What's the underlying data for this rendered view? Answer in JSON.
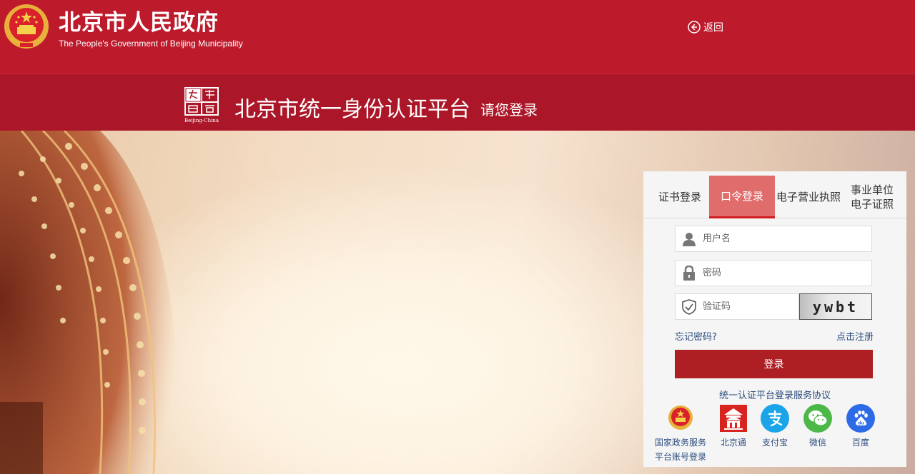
{
  "header": {
    "title": "北京市人民政府",
    "subtitle": "The People's Government of Beijing Municipality",
    "back_label": "返回"
  },
  "subheader": {
    "platform_title": "北京市统一身份认证平台",
    "platform_hint": "请您登录",
    "logo_caption": "Beijing-China"
  },
  "login": {
    "tabs": [
      {
        "label": "证书登录"
      },
      {
        "label": "口令登录",
        "active": true
      },
      {
        "label": "电子营业执照"
      },
      {
        "label_line1": "事业单位",
        "label_line2": "电子证照"
      }
    ],
    "username_placeholder": "用户名",
    "password_placeholder": "密码",
    "captcha_placeholder": "验证码",
    "captcha_text": "ywbt",
    "forgot_label": "忘记密码?",
    "register_label": "点击注册",
    "submit_label": "登录",
    "agreement_label": "统一认证平台登录服务协议"
  },
  "third_party": [
    {
      "label_line1": "国家政务服务",
      "label_line2": "平台账号登录",
      "icon": "national-emblem-icon"
    },
    {
      "label": "北京通",
      "icon": "beijingtong-icon"
    },
    {
      "label": "支付宝",
      "icon": "alipay-icon"
    },
    {
      "label": "微信",
      "icon": "wechat-icon"
    },
    {
      "label": "百度",
      "icon": "baidu-icon"
    }
  ],
  "colors": {
    "header_red": "#bd1a2c",
    "subheader_red": "#ab1728",
    "button_red": "#ae1f23",
    "active_tab": "#e06c6c",
    "link_blue": "#2b4c7e"
  }
}
